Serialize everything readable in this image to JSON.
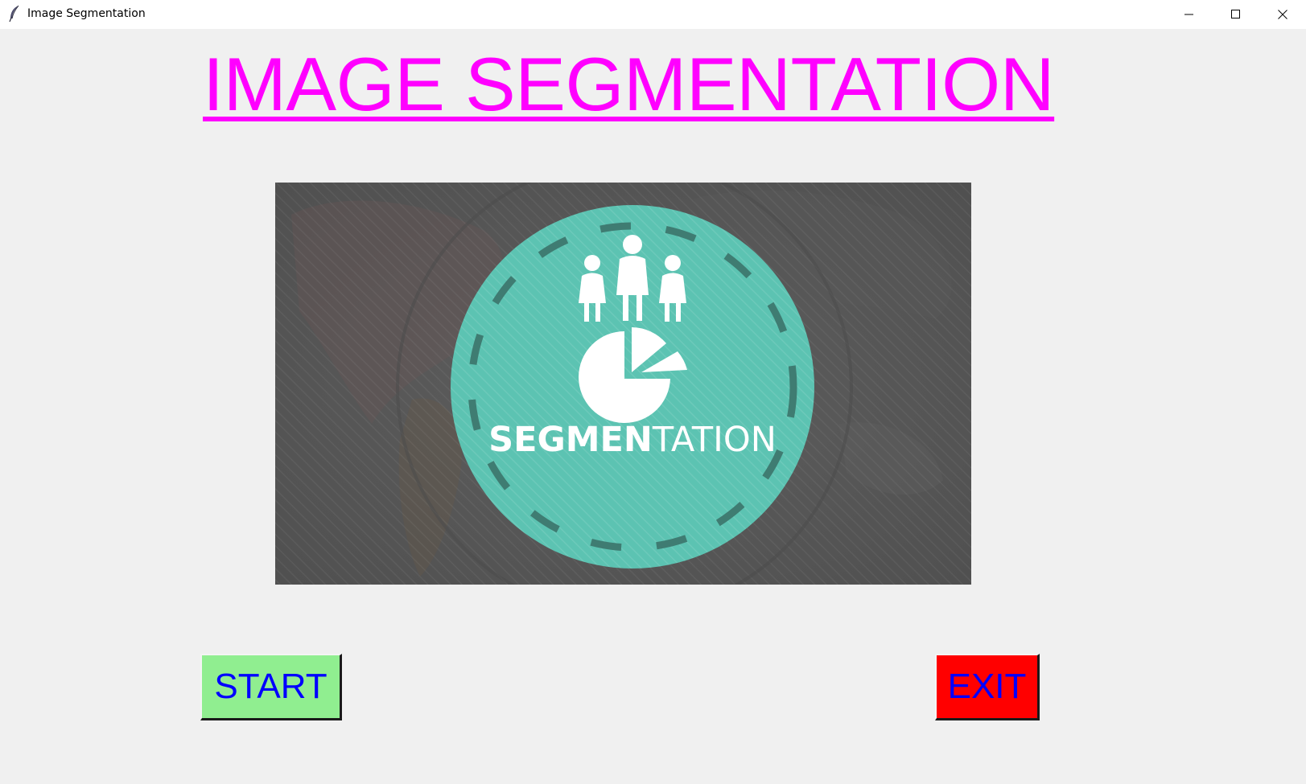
{
  "window": {
    "title": "Image Segmentation",
    "app_icon": "feather-icon",
    "controls": [
      "minimize-icon",
      "maximize-icon",
      "close-icon"
    ]
  },
  "main": {
    "title": "IMAGE SEGMENTATION",
    "title_color": "#ff00ff",
    "image": {
      "caption": "SEGMENTATION",
      "caption_bold_part": "SEGMEN",
      "caption_light_part": "TATION",
      "icons": [
        "people-group-icon",
        "pie-chart-icon"
      ],
      "badge_color": "#5cc3b2",
      "background_color": "#565656"
    }
  },
  "buttons": {
    "start_label": "START",
    "start_color": "#90ee90",
    "exit_label": "EXIT",
    "exit_color": "#ff0000",
    "text_color": "#0000ff"
  }
}
